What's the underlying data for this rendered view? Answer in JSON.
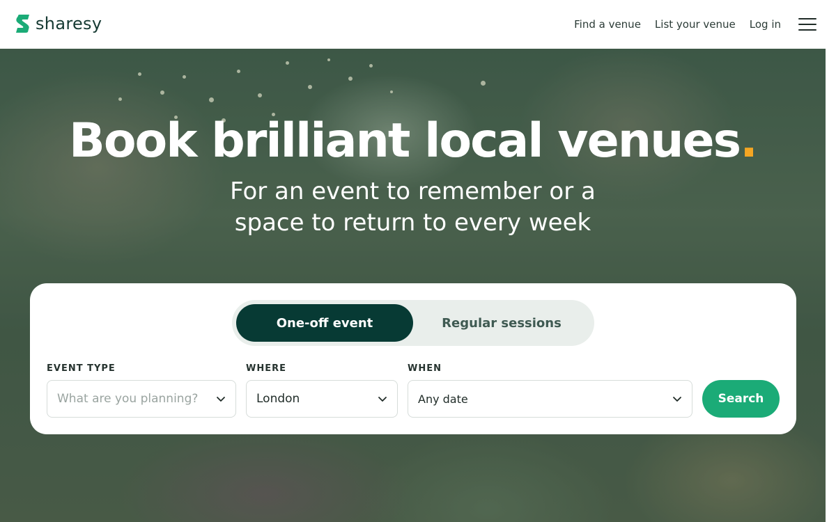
{
  "brand": {
    "name": "sharesy",
    "color": "#1bab77"
  },
  "nav": {
    "find_venue": "Find a venue",
    "list_venue": "List your venue",
    "login": "Log in",
    "menu_icon": "hamburger-menu-icon"
  },
  "hero": {
    "title": "Book brilliant local venues",
    "title_dot": ".",
    "subtitle": "For an event to remember or a space to return to every week"
  },
  "search": {
    "tabs": [
      {
        "label": "One-off event",
        "selected": true
      },
      {
        "label": "Regular sessions",
        "selected": false
      }
    ],
    "event_type": {
      "label": "EVENT TYPE",
      "placeholder": "What are you planning?"
    },
    "where": {
      "label": "WHERE",
      "value": "London"
    },
    "when": {
      "label": "WHEN",
      "value": "Any date"
    },
    "button": "Search"
  },
  "colors": {
    "accent_dot": "#f5a623",
    "active_tab": "#073a34",
    "search_button": "#1bab77"
  }
}
